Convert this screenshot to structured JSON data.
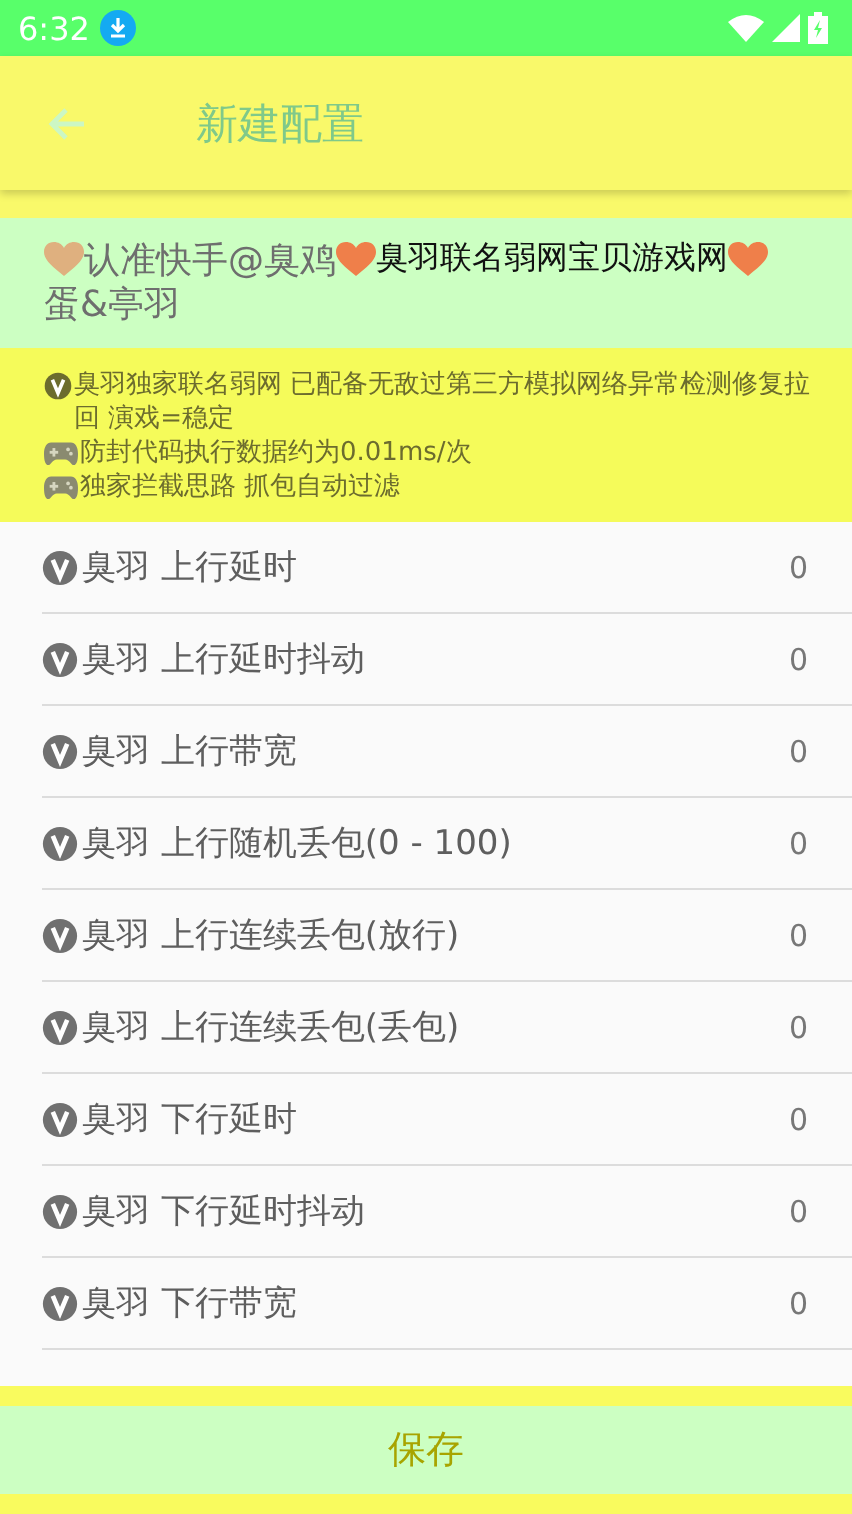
{
  "status_bar": {
    "time": "6:32"
  },
  "app_bar": {
    "title": "新建配置"
  },
  "banner": {
    "line_1": [
      {
        "kind": "heart",
        "color": "#dfb07f"
      },
      {
        "kind": "text",
        "text": "认准快手@臭鸡 ",
        "emphasis": false
      },
      {
        "kind": "heart",
        "color": "#ef7f4a"
      },
      {
        "kind": "text",
        "text": "臭羽联名弱网宝贝游戏网",
        "emphasis": true
      },
      {
        "kind": "heart",
        "color": "#ef7f4a"
      }
    ],
    "line_2": "蛋&亭羽"
  },
  "info": [
    {
      "kind": "badge",
      "text": "臭羽独家联名弱网 已配备无敌过第三方模拟网络异常检测修复拉回 演戏=稳定"
    },
    {
      "kind": "gamepad",
      "text": "防封代码执行数据约为0.01ms/次"
    },
    {
      "kind": "gamepad",
      "text": "独家拦截思路 抓包自动过滤"
    }
  ],
  "settings": [
    {
      "label": "臭羽 上行延时",
      "value": "0"
    },
    {
      "label": "臭羽 上行延时抖动",
      "value": "0"
    },
    {
      "label": "臭羽 上行带宽",
      "value": "0"
    },
    {
      "label": "臭羽 上行随机丢包(0 - 100)",
      "value": "0"
    },
    {
      "label": "臭羽 上行连续丢包(放行)",
      "value": "0"
    },
    {
      "label": "臭羽 上行连续丢包(丢包)",
      "value": "0"
    },
    {
      "label": "臭羽 下行延时",
      "value": "0"
    },
    {
      "label": "臭羽 下行延时抖动",
      "value": "0"
    },
    {
      "label": "臭羽 下行带宽",
      "value": "0"
    }
  ],
  "save_button": {
    "label": "保存"
  }
}
